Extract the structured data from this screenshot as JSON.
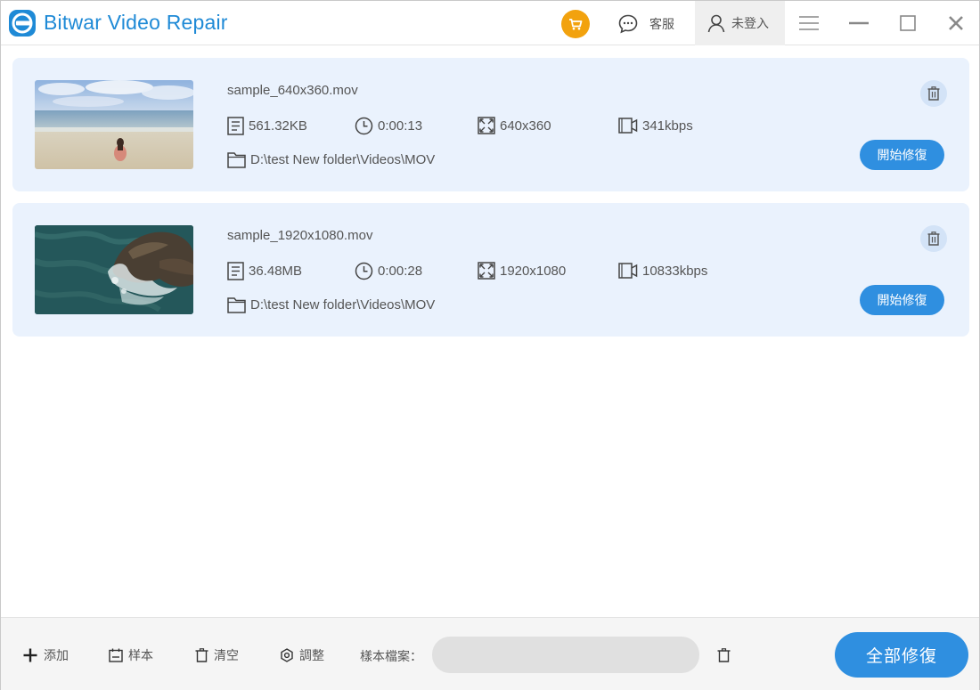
{
  "app": {
    "title": "Bitwar Video Repair"
  },
  "header": {
    "cart_icon": "cart-icon",
    "service_label": "客服",
    "login_label": "未登入",
    "brand_color": "#1f8ad6",
    "cart_color": "#f2a20e"
  },
  "files": [
    {
      "name": "sample_640x360.mov",
      "size": "561.32KB",
      "duration": "0:00:13",
      "resolution": "640x360",
      "bitrate": "341kbps",
      "path": "D:\\test New folder\\Videos\\MOV",
      "repair_label": "開始修復",
      "thumbnail": "beach-scene"
    },
    {
      "name": "sample_1920x1080.mov",
      "size": "36.48MB",
      "duration": "0:00:28",
      "resolution": "1920x1080",
      "bitrate": "10833kbps",
      "path": "D:\\test New folder\\Videos\\MOV",
      "repair_label": "開始修復",
      "thumbnail": "ocean-rocks-aerial"
    }
  ],
  "toolbar": {
    "add_label": "添加",
    "sample_label": "样本",
    "clear_label": "清空",
    "adjust_label": "調整",
    "sample_file_label": "樣本檔案：",
    "sample_file_value": "",
    "repair_all_label": "全部修復",
    "accent_color": "#2f8fe0"
  }
}
